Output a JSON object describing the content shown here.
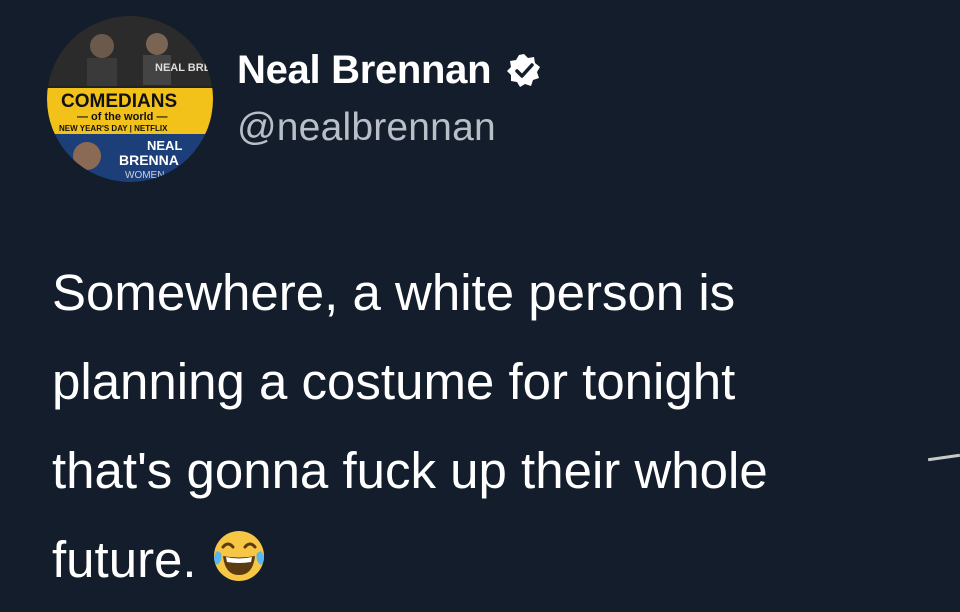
{
  "tweet": {
    "author": {
      "display_name": "Neal Brennan",
      "handle": "@nealbrennan",
      "verified": true,
      "avatar": {
        "description_icon": "profile-avatar",
        "text_top": "NEAL BRENNAN",
        "banner_title": "COMEDIANS",
        "banner_subtitle": "— of the world —",
        "banner_footer": "NEW YEAR'S DAY | NETFLIX",
        "bottom_text_1": "NEAL",
        "bottom_text_2": "BRENNA",
        "bottom_text_3": "WOMEN"
      }
    },
    "text_lines": [
      "Somewhere, a white person is",
      "planning a costume for tonight",
      "that's gonna fuck up their whole",
      "future."
    ],
    "emoji": "face-with-tears-of-joy-icon"
  },
  "colors": {
    "background": "#141d2b",
    "name": "#ffffff",
    "handle": "#b8bfc7",
    "banner_yellow": "#f2c21b",
    "netflix_red": "#e50914"
  }
}
